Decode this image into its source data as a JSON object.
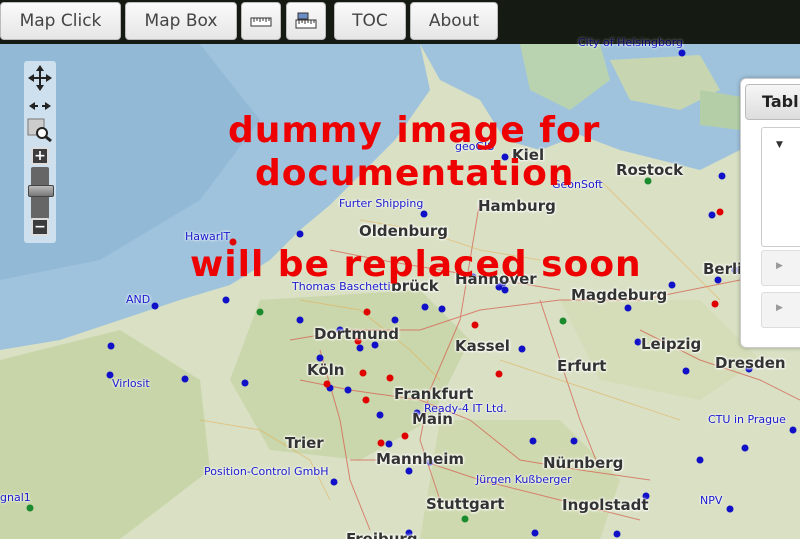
{
  "toolbar": {
    "buttons": [
      "Map Click",
      "Map Box",
      "",
      "",
      "TOC",
      "About"
    ],
    "icon_names": [
      "ruler-icon",
      "measure-area-icon"
    ]
  },
  "map": {
    "overlay_line1": "dummy image for",
    "overlay_line2": "documentation",
    "overlay_line3": "will be replaced soon",
    "cities": [
      "Kiel",
      "Rostock",
      "Hamburg",
      "Oldenburg",
      "Hannover",
      "Magdeburg",
      "Dortmund",
      "Kassel",
      "Leipzig",
      "Dresden",
      "Köln",
      "Erfurt",
      "Frankfurt",
      "Main",
      "Trier",
      "Mannheim",
      "Nürnberg",
      "Stuttgart",
      "Ingolstadt",
      "Berlin",
      "Freiburg",
      "brück"
    ],
    "companies": [
      "City of Helsingborg",
      "geoGIS",
      "GeonSoft",
      "Furter Shipping",
      "HawarIT",
      "Thomas Baschetti",
      "AND",
      "Virlosit",
      "Ready-4 IT Ltd.",
      "CTU in Prague",
      "Position-Control GmbH",
      "Jürgen Kußberger",
      "NPV",
      "gnal1"
    ]
  },
  "panel": {
    "tab_label": "Tabl"
  },
  "colors": {
    "text_red": "#ee0000",
    "company_blue": "#1a1acc",
    "marker_blue": "#1010c8",
    "marker_red": "#e00000",
    "marker_green": "#1c8a2e"
  }
}
